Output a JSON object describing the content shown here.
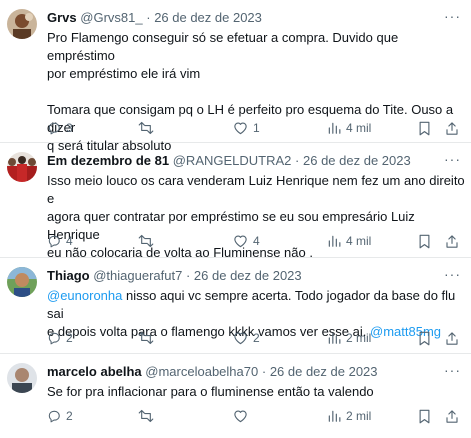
{
  "tweets": [
    {
      "name": "Grvs",
      "handle": "@Grvs81_",
      "date": "26 de dez de 2023",
      "lines": [
        "Pro Flamengo conseguir só se efetuar a compra. Duvido que empréstimo",
        "por empréstimo ele irá vim",
        "",
        "Tomara que consigam pq o LH é perfeito pro esquema do Tite. Ouso a dizer",
        "q será titular absoluto"
      ],
      "replies": "3",
      "retweets": "",
      "likes": "1",
      "views": "4 mil"
    },
    {
      "name": "Em dezembro de 81",
      "handle": "@RANGELDUTRA2",
      "date": "26 de dez de 2023",
      "lines": [
        "Isso meio louco os cara venderam Luiz Henrique nem fez um ano direito e",
        "agora quer contratar por empréstimo se eu sou empresário Luiz Henrique",
        "eu não colocaria de volta ao Fluminense não  ."
      ],
      "replies": "4",
      "retweets": "",
      "likes": "4",
      "views": "4 mil"
    },
    {
      "name": "Thiago",
      "handle": "@thiaguerafut7",
      "date": "26 de dez de 2023",
      "mention1": "@eunoronha",
      "line1_rest": " nisso aqui vc sempre acerta. Todo jogador da base do flu sai",
      "line2_text": "e depois volta para o flamengo kkkk vamos ver esse ai. ",
      "mention2": "@matt85mg",
      "replies": "2",
      "retweets": "",
      "likes": "2",
      "views": "2 mil"
    },
    {
      "name": "marcelo abelha",
      "handle": "@marceloabelha70",
      "date": "26 de dez de 2023",
      "lines": [
        "Se for pra inflacionar para o fluminense então ta valendo"
      ],
      "replies": "2",
      "retweets": "",
      "likes": "",
      "views": "2 mil"
    }
  ],
  "separator": "·",
  "more_glyph": "···",
  "colors": {
    "text": "#0f1419",
    "secondary": "#536471",
    "link": "#1d9bf0",
    "divider": "#e7e9ea"
  },
  "icons": [
    "reply-icon",
    "retweet-icon",
    "like-icon",
    "views-icon",
    "bookmark-icon",
    "share-icon",
    "more-icon"
  ]
}
